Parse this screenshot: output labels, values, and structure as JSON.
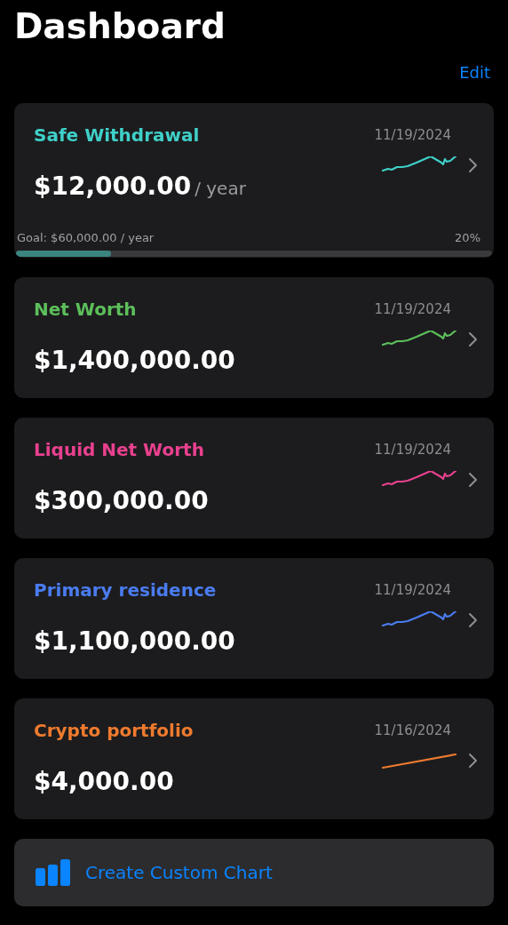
{
  "title": "Dashboard",
  "edit": "Edit",
  "cards": [
    {
      "name": "Safe Withdrawal",
      "color": "#3fd0c9",
      "date": "11/19/2024",
      "value": "$12,000.00",
      "unit": "/ year",
      "kind": "wavy",
      "goal": "Goal: $60,000.00 / year",
      "percent": "20%",
      "level": 0.2
    },
    {
      "name": "Net Worth",
      "color": "#5cbf5a",
      "date": "11/19/2024",
      "value": "$1,400,000.00",
      "kind": "wavy"
    },
    {
      "name": "Liquid Net Worth",
      "color": "#e9408f",
      "date": "11/19/2024",
      "value": "$300,000.00",
      "kind": "wavy"
    },
    {
      "name": "Primary residence",
      "color": "#4a7cf0",
      "date": "11/19/2024",
      "value": "$1,100,000.00",
      "kind": "wavy"
    },
    {
      "name": "Crypto portfolio",
      "color": "#ef7a2e",
      "date": "11/16/2024",
      "value": "$4,000.00",
      "kind": "straight"
    }
  ],
  "create_button": "Create Custom Chart"
}
